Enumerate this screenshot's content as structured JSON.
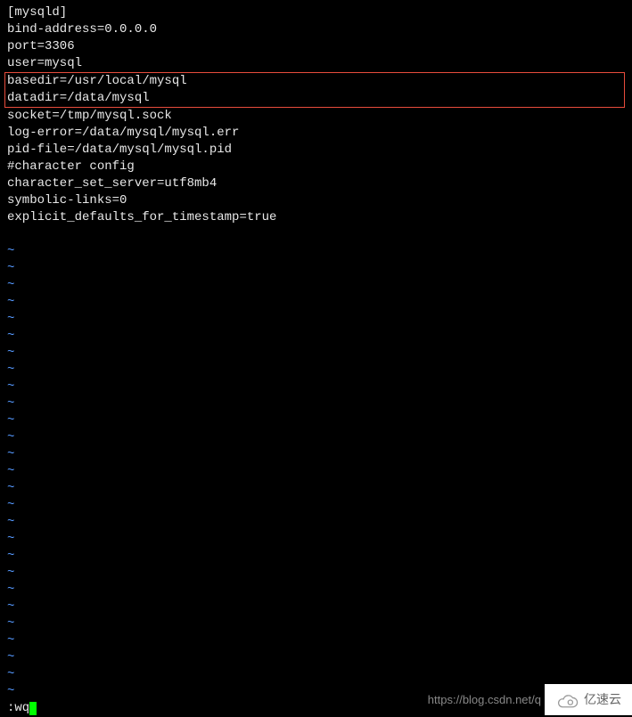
{
  "config": {
    "lines": [
      "[mysqld]",
      "bind-address=0.0.0.0",
      "port=3306",
      "user=mysql"
    ],
    "highlighted": [
      "basedir=/usr/local/mysql",
      "datadir=/data/mysql"
    ],
    "lines_after": [
      "socket=/tmp/mysql.sock",
      "log-error=/data/mysql/mysql.err",
      "pid-file=/data/mysql/mysql.pid",
      "#character config",
      "character_set_server=utf8mb4",
      "symbolic-links=0",
      "explicit_defaults_for_timestamp=true"
    ]
  },
  "tilde": "~",
  "tilde_count": 27,
  "command": ":wq",
  "watermark": {
    "url": "https://blog.csdn.net/q",
    "brand": "亿速云"
  }
}
